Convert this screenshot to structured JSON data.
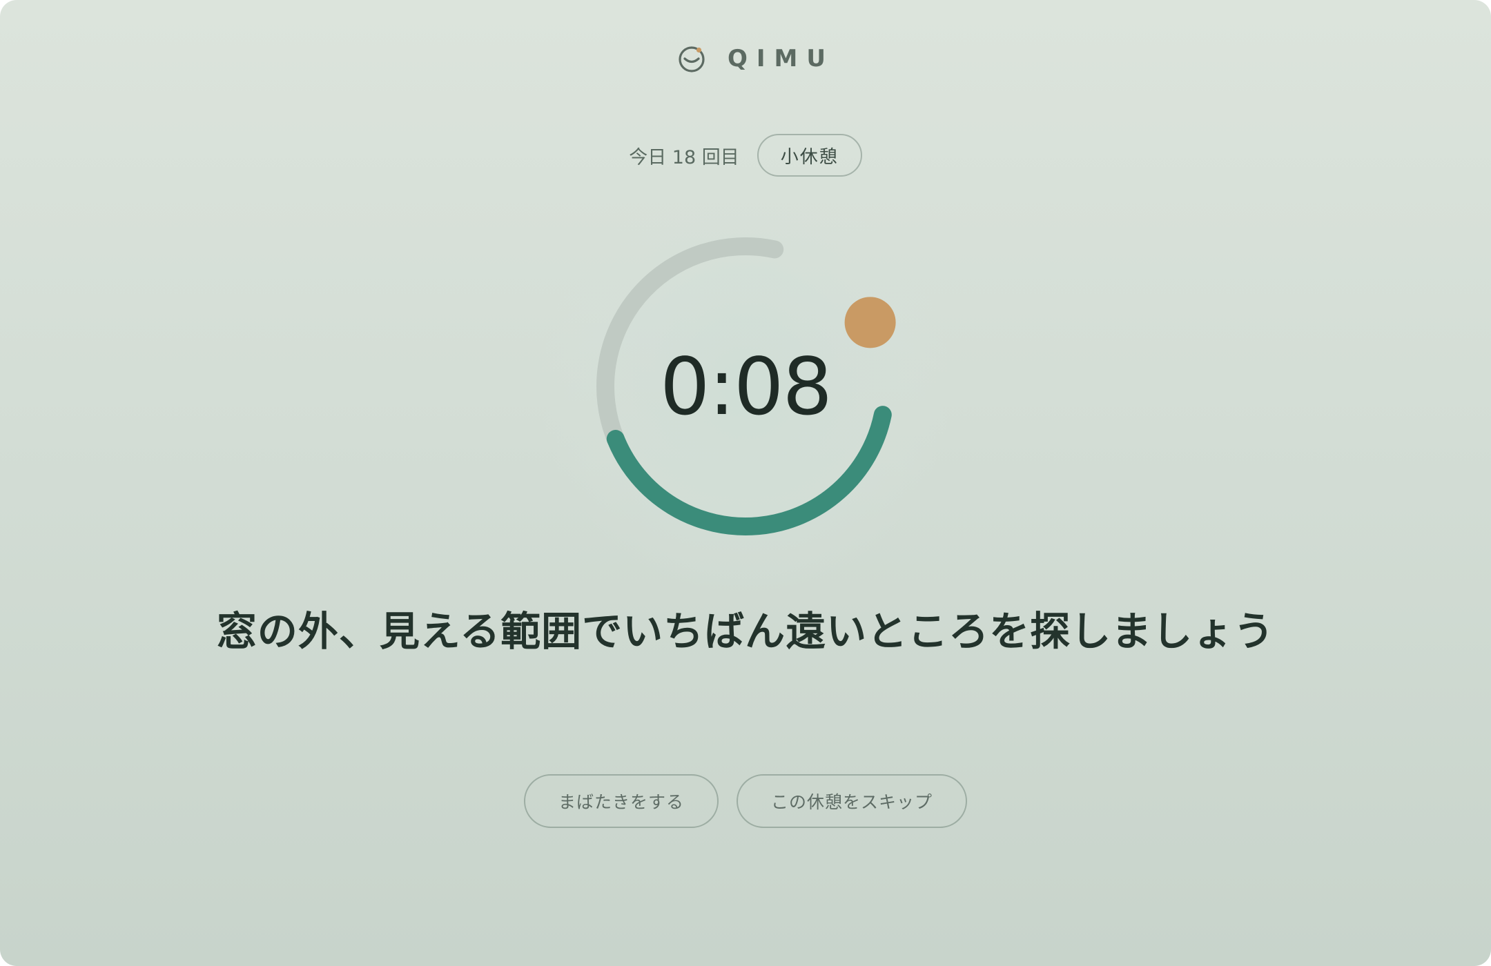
{
  "brand": {
    "name": "QIMU",
    "icon": "smile-face-logo-icon",
    "accent_color": "#c99a64"
  },
  "session": {
    "count_label": "今日 18 回目",
    "break_type": "小休憩"
  },
  "timer": {
    "display": "0:08",
    "progress": 0.62,
    "ring_color": "#3b8c7a",
    "track_color": "#c0cac3",
    "indicator_color": "#c99a64"
  },
  "prompt": {
    "text": "窓の外、見える範囲でいちばん遠いところを探しましょう"
  },
  "actions": {
    "blink_label": "まばたきをする",
    "skip_label": "この休憩をスキップ"
  }
}
